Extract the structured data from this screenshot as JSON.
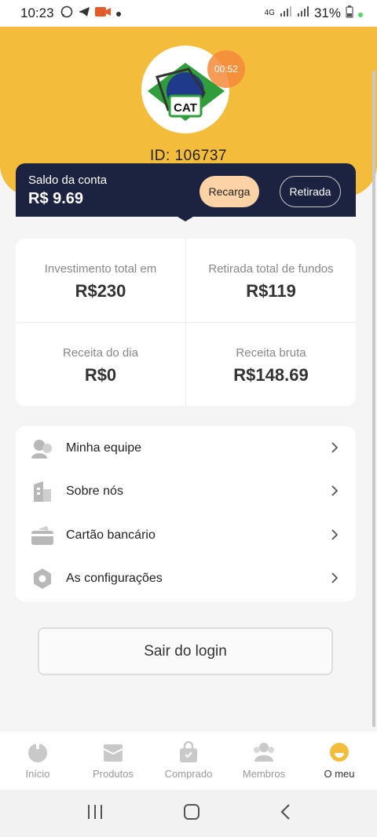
{
  "status_bar": {
    "time": "10:23",
    "network": "4G",
    "battery": "31%"
  },
  "profile": {
    "avatar_text": "CAT",
    "timer": "00:52",
    "id_label": "ID:",
    "id_value": "106737"
  },
  "balance": {
    "label": "Saldo da conta",
    "value": "R$ 9.69",
    "recarga_label": "Recarga",
    "retirada_label": "Retirada"
  },
  "stats": [
    {
      "label": "Investimento total em",
      "value": "R$230"
    },
    {
      "label": "Retirada total de fundos",
      "value": "R$119"
    },
    {
      "label": "Receita do dia",
      "value": "R$0"
    },
    {
      "label": "Receita bruta",
      "value": "R$148.69"
    }
  ],
  "menu": [
    {
      "label": "Minha equipe",
      "icon": "team-icon"
    },
    {
      "label": "Sobre nós",
      "icon": "building-icon"
    },
    {
      "label": "Cartão bancário",
      "icon": "card-icon"
    },
    {
      "label": "As configurações",
      "icon": "settings-icon"
    }
  ],
  "logout_label": "Sair do login",
  "tabs": [
    {
      "label": "Início",
      "icon": "home-icon",
      "active": false
    },
    {
      "label": "Produtos",
      "icon": "products-icon",
      "active": false
    },
    {
      "label": "Comprado",
      "icon": "bag-icon",
      "active": false
    },
    {
      "label": "Membros",
      "icon": "members-icon",
      "active": false
    },
    {
      "label": "O meu",
      "icon": "profile-icon",
      "active": true
    }
  ],
  "colors": {
    "header": "#f4bc3b",
    "balance_bg": "#1c2340",
    "recarga_bg": "#fcd3a6",
    "active_tab_icon": "#f4bc3b"
  }
}
